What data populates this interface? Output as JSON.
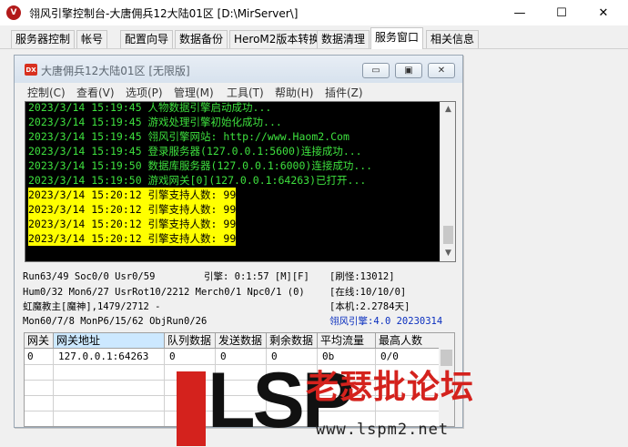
{
  "outer": {
    "icon_text": "V",
    "title": "翎风引擎控制台-大唐佣兵12大陆01区 [D:\\MirServer\\]",
    "controls": {
      "minimize": "—",
      "maximize": "☐",
      "close": "✕"
    }
  },
  "tabs": [
    {
      "label": "服务器控制",
      "active": false
    },
    {
      "label": "帐号",
      "active": false
    },
    {
      "label": "配置向导",
      "active": false
    },
    {
      "label": "数据备份",
      "active": false
    },
    {
      "label": "HeroM2版本转换",
      "active": false
    },
    {
      "label": "数据清理",
      "active": false
    },
    {
      "label": "服务窗口",
      "active": true
    },
    {
      "label": "相关信息",
      "active": false
    }
  ],
  "child": {
    "icon_text": "DX",
    "title": "大唐佣兵12大陆01区 [无限版]",
    "controls": {
      "minimize": "▭",
      "restore": "▣",
      "close": "✕"
    },
    "menu": [
      "控制(C)",
      "查看(V)",
      "选项(P)",
      "管理(M)",
      "工具(T)",
      "帮助(H)",
      "插件(Z)"
    ]
  },
  "console": {
    "text_color": "#3ee03e",
    "highlight_color": "#ffff00",
    "lines": [
      {
        "text": "2023/3/14 15:19:45 人物数据引擎启动成功...",
        "highlight": false
      },
      {
        "text": "2023/3/14 15:19:45 游戏处理引擎初始化成功...",
        "highlight": false
      },
      {
        "text": "2023/3/14 15:19:45 翎风引擎网站: http://www.Haom2.Com",
        "highlight": false
      },
      {
        "text": "2023/3/14 15:19:45 登录服务器(127.0.0.1:5600)连接成功...",
        "highlight": false
      },
      {
        "text": "2023/3/14 15:19:50 数据库服务器(127.0.0.1:6000)连接成功...",
        "highlight": false
      },
      {
        "text": "2023/3/14 15:19:50 游戏网关[0](127.0.0.1:64263)已打开...",
        "highlight": false
      },
      {
        "text": "2023/3/14 15:20:12 引擎支持人数: 99",
        "highlight": true
      },
      {
        "text": "2023/3/14 15:20:12 引擎支持人数: 99",
        "highlight": true
      },
      {
        "text": "2023/3/14 15:20:12 引擎支持人数: 99",
        "highlight": true
      },
      {
        "text": "2023/3/14 15:20:12 引擎支持人数: 99",
        "highlight": true
      }
    ]
  },
  "status": {
    "run": "Run63/49 Soc0/0 Usr0/59",
    "engine": "引擎: 0:1:57 [M][F]",
    "monsters": "[刷怪:13012]",
    "hum": "Hum0/32 Mon6/27 UsrRot10/2212 Merch0/1 Npc0/1 (0)",
    "online": "[在线:10/10/0]",
    "boss": "虹魔教主[魔神],1479/2712 -",
    "local": "[本机:2.2784天]",
    "mon": "Mon60/7/8 MonP6/15/62 ObjRun0/26",
    "version": "翎风引擎:4.0 20230314"
  },
  "gateway_table": {
    "headers": [
      "网关",
      "网关地址",
      "队列数据",
      "发送数据",
      "剩余数据",
      "平均流量",
      "最高人数"
    ],
    "rows": [
      [
        "0",
        "127.0.0.1:64263",
        "0",
        "0",
        "0",
        "0b",
        "0/0"
      ]
    ]
  },
  "watermark": {
    "brand": "LSP",
    "cn": "老瑟批论坛",
    "url": "www.lspm2.net",
    "accent": "#d4221d"
  }
}
